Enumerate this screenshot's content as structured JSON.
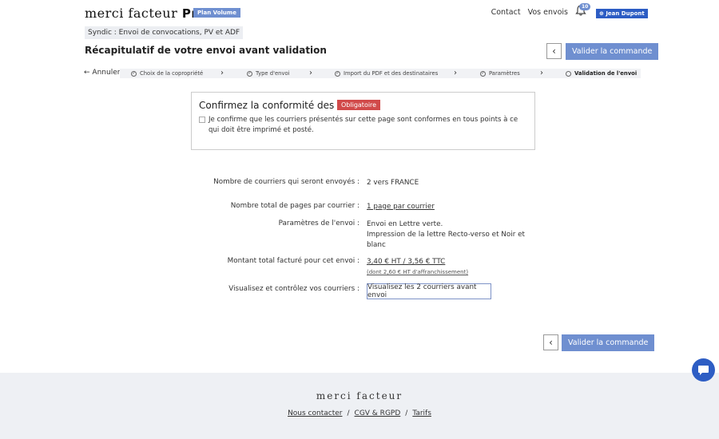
{
  "header": {
    "logo": "merci facteur",
    "logo_suffix": "Pro",
    "plan_badge": "Plan Volume",
    "nav": {
      "contact": "Contact",
      "envois": "Vos envois"
    },
    "notifications_count": "10",
    "user": "Jean Dupont"
  },
  "context_tag": "Syndic : Envoi de convocations, PV et ADF",
  "page_title": "Récapitulatif de votre envoi avant validation",
  "validate_label": "Valider la commande",
  "stepper": {
    "back": "Annuler",
    "steps": [
      {
        "label": "Choix de la copropriété"
      },
      {
        "label": "Type d'envoi"
      },
      {
        "label": "Import du PDF et des destinataires"
      },
      {
        "label": "Paramètres"
      },
      {
        "label": "Validation de l'envoi"
      }
    ]
  },
  "confirm": {
    "title": "Confirmez la conformité des envois",
    "required": "Obligatoire",
    "text": "Je confirme que les courriers présentés sur cette page sont conformes en tous points à ce qui doit être imprimé et posté."
  },
  "summary": {
    "count_label": "Nombre de courriers qui seront envoyés :",
    "count_value": "2 vers FRANCE",
    "pages_label": "Nombre total de pages par courrier :",
    "pages_value": "1 page par courrier",
    "params_label": "Paramètres de l'envoi :",
    "params_line1": "Envoi en Lettre verte.",
    "params_line2": "Impression de la lettre Recto-verso et Noir et",
    "params_line3": "blanc",
    "amount_label": "Montant total facturé pour cet envoi :",
    "amount_value": "3,40 € HT / 3,56 € TTC",
    "amount_sub": "(dont 2,60 € HT d'affranchissement)",
    "preview_label": "Visualisez et contrôlez vos courriers :",
    "preview_button": "Visualisez les 2 courriers avant envoi"
  },
  "footer": {
    "logo": "merci facteur",
    "links": [
      "Nous contacter",
      "CGV & RGPD",
      "Tarifs"
    ]
  },
  "colors": {
    "accent": "#6f8fd0",
    "user_badge": "#2d5dc4",
    "required": "#d14a4a"
  }
}
